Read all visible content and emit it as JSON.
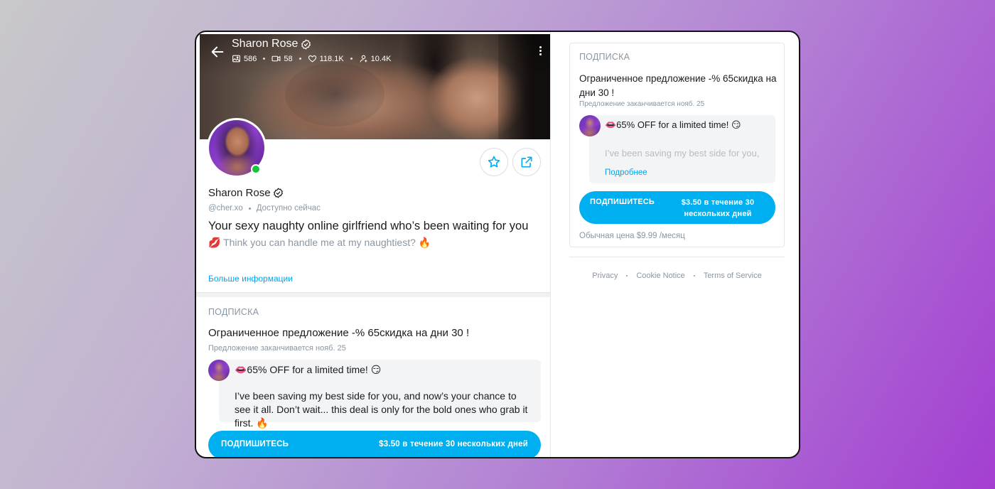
{
  "colors": {
    "accent": "#00aff0",
    "link": "#00a6eb",
    "muted": "#8a96a3",
    "online": "#19c33c"
  },
  "cover": {
    "name": "Sharon Rose",
    "stats": {
      "photos": "586",
      "videos": "58",
      "likes": "118.1K",
      "fans": "10.4K"
    }
  },
  "profile": {
    "name": "Sharon Rose",
    "handle": "@cher.xo",
    "status": "Доступно сейчас",
    "bio_title": "Your sexy naughty online girlfriend who’s been waiting for you",
    "bio_line": "💋 Think you can handle me at my naughtiest? 🔥",
    "more_info": "Больше информации"
  },
  "subscription": {
    "label": "ПОДПИСКА",
    "offer_title": "Ограниченное предложение -% 65скидка на дни 30 !",
    "offer_ends": "Предложение заканчивается нояб. 25",
    "promo_title": "👄65% OFF for a limited time! 😏",
    "promo_text": "I’ve been saving my best side for you, and now’s your chance to see it all. Don’t wait... this deal is only for the bold ones who grab it first. 🔥",
    "promo_text_short": "I’ve been saving my best side for you,",
    "read_more": "Подробнее",
    "button_label": "ПОДПИШИТЕСЬ",
    "button_price": "$3.50 в течение 30 нескольких дней",
    "regular_price": "Обычная цена $9.99 /месяц"
  },
  "footer": {
    "privacy": "Privacy",
    "cookie": "Cookie Notice",
    "terms": "Terms of Service"
  }
}
